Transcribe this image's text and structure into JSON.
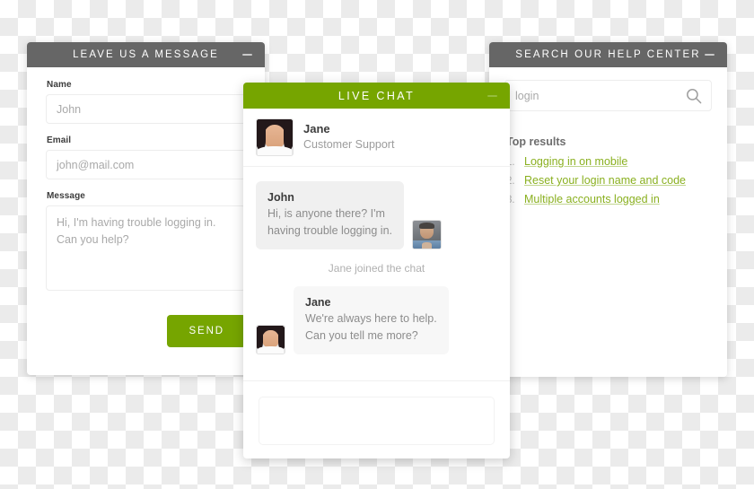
{
  "contact_panel": {
    "title": "LEAVE US A MESSAGE",
    "minimize_icon": "minimize-icon",
    "fields": {
      "name": {
        "label": "Name",
        "value": "John"
      },
      "email": {
        "label": "Email",
        "value": "john@mail.com"
      },
      "message": {
        "label": "Message",
        "line1": "Hi, I'm having trouble logging in.",
        "line2": "Can you help?"
      }
    },
    "send_label": "SEND"
  },
  "help_panel": {
    "title": "SEARCH OUR HELP CENTER",
    "minimize_icon": "minimize-icon",
    "search": {
      "value": "login",
      "icon": "search-icon"
    },
    "results_heading": "Top results",
    "results": [
      {
        "number": "1.",
        "label": "Logging in on mobile"
      },
      {
        "number": "2.",
        "label": "Reset your login name and code"
      },
      {
        "number": "3.",
        "label": "Multiple accounts logged in"
      }
    ]
  },
  "chat_panel": {
    "title": "LIVE CHAT",
    "minimize_icon": "minimize-icon",
    "agent": {
      "name": "Jane",
      "role": "Customer Support",
      "avatar": "jane-avatar"
    },
    "messages": [
      {
        "sender": "John",
        "line1": "Hi, is anyone there? I'm",
        "line2": "having trouble logging in.",
        "avatar": "john-avatar"
      },
      {
        "sender": "Jane",
        "line1": "We're always here to help.",
        "line2": "Can you tell me more?",
        "avatar": "jane-avatar"
      }
    ],
    "system_note": "Jane joined the chat",
    "composer_value": ""
  },
  "colors": {
    "accent_green": "#76a500",
    "header_gray": "#666666",
    "link_green": "#8ab020"
  }
}
